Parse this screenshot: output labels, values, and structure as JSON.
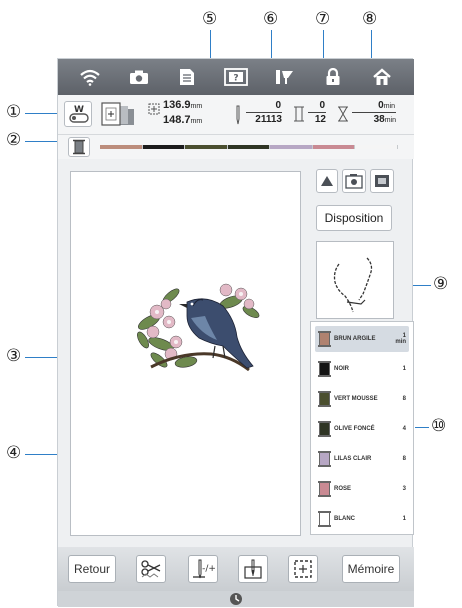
{
  "callouts": [
    "①",
    "②",
    "③",
    "④",
    "⑤",
    "⑥",
    "⑦",
    "⑧",
    "⑨",
    "⑩"
  ],
  "topbar": {
    "icons": [
      "wifi-icon",
      "camera-icon",
      "document-icon",
      "help-icon",
      "thread-icon",
      "lock-icon",
      "home-icon"
    ]
  },
  "info": {
    "size_w": "136.9",
    "size_h": "148.7",
    "size_unit": "mm",
    "stitch_current": "0",
    "stitch_total": "21113",
    "color_current": "0",
    "color_total": "12",
    "time_current": "0",
    "time_total": "38",
    "time_unit": "min"
  },
  "progress": {
    "value": 0,
    "segment_colors": [
      "#bc8d7c",
      "#1c1c1c",
      "#4b4f2f",
      "#2f3524",
      "#b7a7c4",
      "#c98a93",
      "#f5f5f5"
    ]
  },
  "side": {
    "disposition_label": "Disposition"
  },
  "threads": [
    {
      "name": "BRUN ARGILE",
      "count": "1",
      "extra": "min",
      "color": "#b08270",
      "selected": true
    },
    {
      "name": "NOIR",
      "count": "1",
      "extra": "",
      "color": "#141414",
      "selected": false
    },
    {
      "name": "VERT MOUSSE",
      "count": "8",
      "extra": "",
      "color": "#4b4f2f",
      "selected": false
    },
    {
      "name": "OLIVE FONCÉ",
      "count": "4",
      "extra": "",
      "color": "#2f3524",
      "selected": false
    },
    {
      "name": "LILAS CLAIR",
      "count": "8",
      "extra": "",
      "color": "#b7a7c4",
      "selected": false
    },
    {
      "name": "ROSE",
      "count": "3",
      "extra": "",
      "color": "#c98a93",
      "selected": false
    },
    {
      "name": "BLANC",
      "count": "1",
      "extra": "",
      "color": "#ffffff",
      "selected": false
    }
  ],
  "bottom": {
    "retour_label": "Retour",
    "memoire_label": "Mémoire"
  }
}
